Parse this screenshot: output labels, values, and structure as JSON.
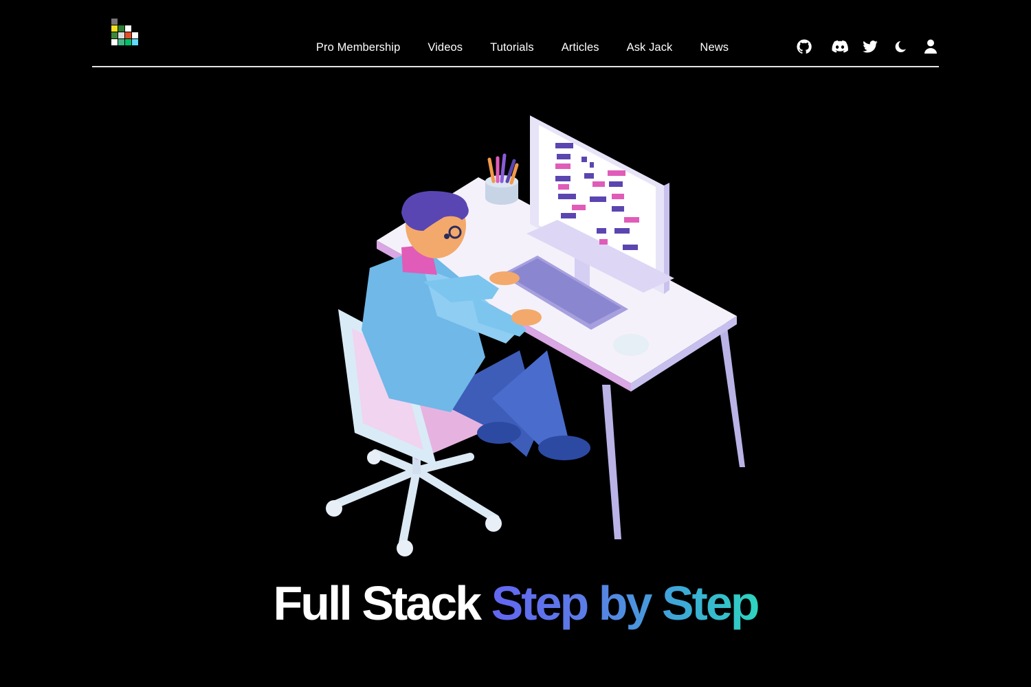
{
  "header": {
    "nav": [
      {
        "label": "Pro Membership"
      },
      {
        "label": "Videos"
      },
      {
        "label": "Tutorials"
      },
      {
        "label": "Articles"
      },
      {
        "label": "Ask Jack"
      },
      {
        "label": "News"
      }
    ],
    "icons": [
      "github-icon",
      "discord-icon",
      "twitter-icon",
      "moon-icon",
      "user-icon"
    ]
  },
  "hero": {
    "title_part1": "Full Stack",
    "title_part2": "Step by Step"
  },
  "colors": {
    "background": "#000000",
    "gradient_start": "#6366f1",
    "gradient_end": "#2dd4bf"
  }
}
